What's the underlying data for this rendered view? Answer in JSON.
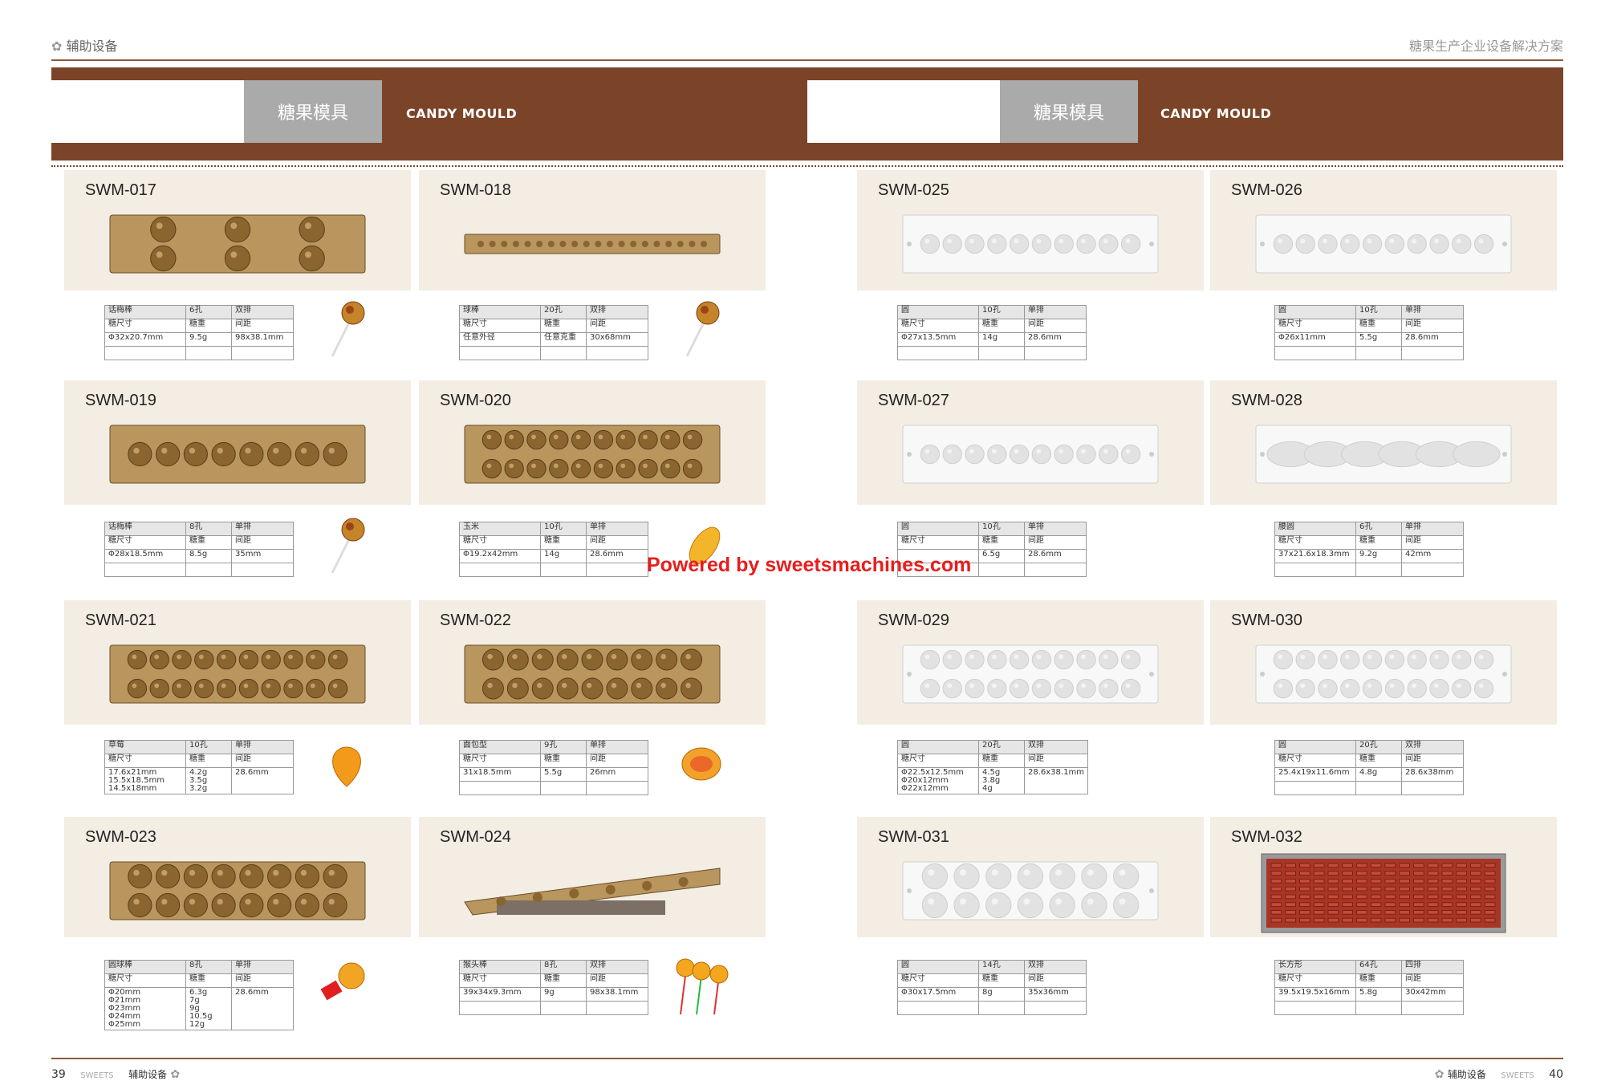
{
  "header": {
    "left": "辅助设备",
    "right": "糖果生产企业设备解决方案"
  },
  "banner": {
    "cn": "糖果模具",
    "en": "CANDY MOULD"
  },
  "watermark": "Powered by sweetsmachines.com",
  "footer": {
    "left_page": "39",
    "left_brand": "SWEETS",
    "left_section": "辅助设备",
    "right_section": "辅助设备",
    "right_brand": "SWEETS",
    "right_page": "40"
  },
  "products": [
    {
      "code": "SWM-017",
      "rows": [
        [
          "话梅棒",
          "6孔",
          "双排"
        ],
        [
          "糖尺寸",
          "糖重",
          "间距"
        ],
        [
          "Φ32x20.7mm",
          "9.5g",
          "98x38.1mm"
        ],
        [
          "",
          "",
          ""
        ]
      ]
    },
    {
      "code": "SWM-018",
      "rows": [
        [
          "球棒",
          "20孔",
          "双排"
        ],
        [
          "糖尺寸",
          "糖重",
          "间距"
        ],
        [
          "任意外径",
          "任意克重",
          "30x68mm"
        ],
        [
          "",
          "",
          ""
        ]
      ]
    },
    {
      "code": "SWM-019",
      "rows": [
        [
          "话梅棒",
          "8孔",
          "单排"
        ],
        [
          "糖尺寸",
          "糖重",
          "间距"
        ],
        [
          "Φ28x18.5mm",
          "8.5g",
          "35mm"
        ],
        [
          "",
          "",
          ""
        ]
      ]
    },
    {
      "code": "SWM-020",
      "rows": [
        [
          "玉米",
          "10孔",
          "单排"
        ],
        [
          "糖尺寸",
          "糖重",
          "间距"
        ],
        [
          "Φ19.2x42mm",
          "14g",
          "28.6mm"
        ],
        [
          "",
          "",
          ""
        ]
      ]
    },
    {
      "code": "SWM-021",
      "rows": [
        [
          "草莓",
          "10孔",
          "单排"
        ],
        [
          "糖尺寸",
          "糖重",
          "间距"
        ],
        [
          "17.6x21mm\n15.5x18.5mm\n14.5x18mm",
          "4.2g\n3.5g\n3.2g",
          "28.6mm"
        ]
      ]
    },
    {
      "code": "SWM-022",
      "rows": [
        [
          "面包型",
          "9孔",
          "单排"
        ],
        [
          "糖尺寸",
          "糖重",
          "间距"
        ],
        [
          "31x18.5mm",
          "5.5g",
          "26mm"
        ],
        [
          "",
          "",
          ""
        ]
      ]
    },
    {
      "code": "SWM-023",
      "rows": [
        [
          "圆球棒",
          "8孔",
          "单排"
        ],
        [
          "糖尺寸",
          "糖重",
          "间距"
        ],
        [
          "Φ20mm\nΦ21mm\nΦ23mm\nΦ24mm\nΦ25mm",
          "6.3g\n7g\n9g\n10.5g\n12g",
          "28.6mm"
        ]
      ]
    },
    {
      "code": "SWM-024",
      "rows": [
        [
          "猴头棒",
          "8孔",
          "双排"
        ],
        [
          "糖尺寸",
          "糖重",
          "间距"
        ],
        [
          "39x34x9.3mm",
          "9g",
          "98x38.1mm"
        ],
        [
          "",
          "",
          ""
        ]
      ]
    },
    {
      "code": "SWM-025",
      "rows": [
        [
          "圆",
          "10孔",
          "单排"
        ],
        [
          "糖尺寸",
          "糖重",
          "间距"
        ],
        [
          "Φ27x13.5mm",
          "14g",
          "28.6mm"
        ],
        [
          "",
          "",
          ""
        ]
      ]
    },
    {
      "code": "SWM-026",
      "rows": [
        [
          "圆",
          "10孔",
          "单排"
        ],
        [
          "糖尺寸",
          "糖重",
          "间距"
        ],
        [
          "Φ26x11mm",
          "5.5g",
          "28.6mm"
        ],
        [
          "",
          "",
          ""
        ]
      ]
    },
    {
      "code": "SWM-027",
      "rows": [
        [
          "圆",
          "10孔",
          "单排"
        ],
        [
          "糖尺寸",
          "糖重",
          "间距"
        ],
        [
          "",
          "6.5g",
          "28.6mm"
        ],
        [
          "",
          "",
          ""
        ]
      ]
    },
    {
      "code": "SWM-028",
      "rows": [
        [
          "腰圆",
          "6孔",
          "单排"
        ],
        [
          "糖尺寸",
          "糖重",
          "间距"
        ],
        [
          "37x21.6x18.3mm",
          "9.2g",
          "42mm"
        ],
        [
          "",
          "",
          ""
        ]
      ]
    },
    {
      "code": "SWM-029",
      "rows": [
        [
          "圆",
          "20孔",
          "双排"
        ],
        [
          "糖尺寸",
          "糖重",
          "间距"
        ],
        [
          "Φ22.5x12.5mm\nΦ20x12mm\nΦ22x12mm",
          "4.5g\n3.8g\n4g",
          "28.6x38.1mm"
        ]
      ]
    },
    {
      "code": "SWM-030",
      "rows": [
        [
          "圆",
          "20孔",
          "双排"
        ],
        [
          "糖尺寸",
          "糖重",
          "间距"
        ],
        [
          "25.4x19x11.6mm",
          "4.8g",
          "28.6x38mm"
        ],
        [
          "",
          "",
          ""
        ]
      ]
    },
    {
      "code": "SWM-031",
      "rows": [
        [
          "圆",
          "14孔",
          "双排"
        ],
        [
          "糖尺寸",
          "糖重",
          "间距"
        ],
        [
          "Φ30x17.5mm",
          "8g",
          "35x36mm"
        ],
        [
          "",
          "",
          ""
        ]
      ]
    },
    {
      "code": "SWM-032",
      "rows": [
        [
          "长方形",
          "64孔",
          "四排"
        ],
        [
          "糖尺寸",
          "糖重",
          "间距"
        ],
        [
          "39.5x19.5x16mm",
          "5.8g",
          "30x42mm"
        ],
        [
          "",
          "",
          ""
        ]
      ]
    }
  ]
}
